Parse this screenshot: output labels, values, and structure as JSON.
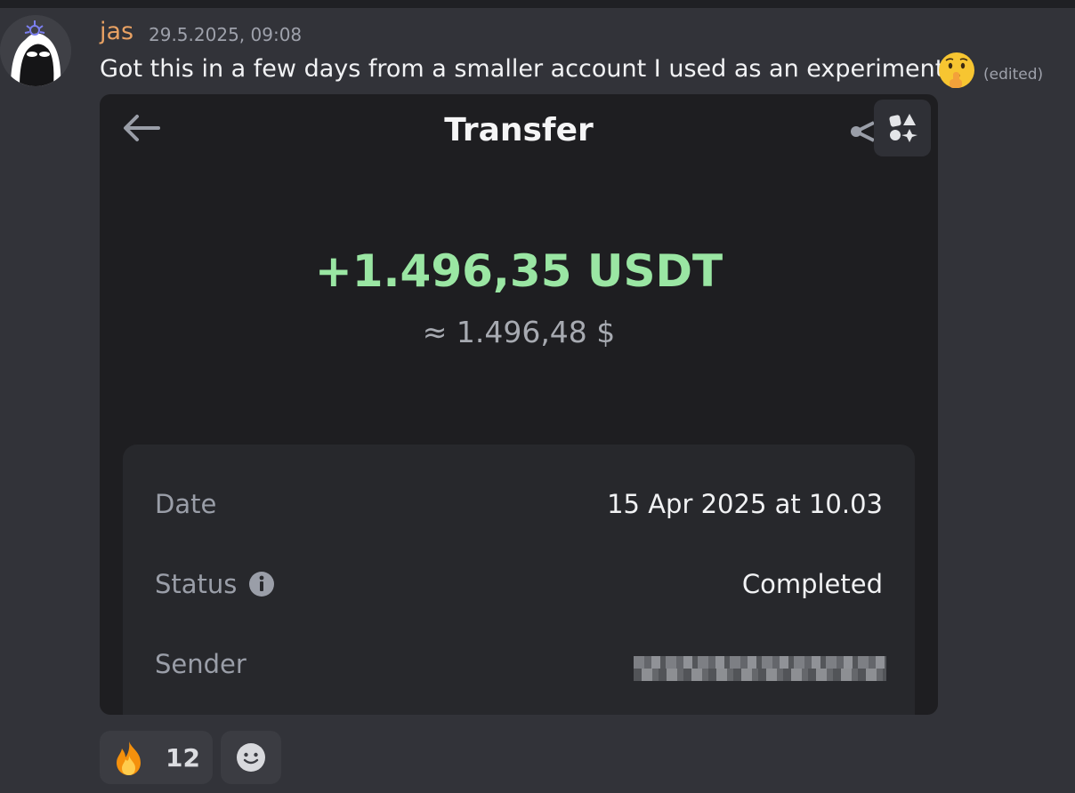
{
  "message": {
    "username": "jas",
    "timestamp": "29.5.2025, 09:08",
    "text": "Got this in a few days from a smaller account I used as an experiment",
    "emoji": "shushing-face",
    "edited_label": "(edited)"
  },
  "card": {
    "title": "Transfer",
    "amount": "+1.496,35 USDT",
    "approx_value": "≈ 1.496,48 $",
    "details": [
      {
        "label": "Date",
        "value": "15 Apr 2025 at 10.03"
      },
      {
        "label": "Status",
        "value": "Completed"
      },
      {
        "label": "Sender",
        "value": ""
      }
    ]
  },
  "reactions": [
    {
      "emoji": "fire",
      "count": "12"
    }
  ],
  "colors": {
    "background": "#323339",
    "username": "#e8a163",
    "amount": "#9ae6a3",
    "card_bg": "#1e1e21"
  }
}
